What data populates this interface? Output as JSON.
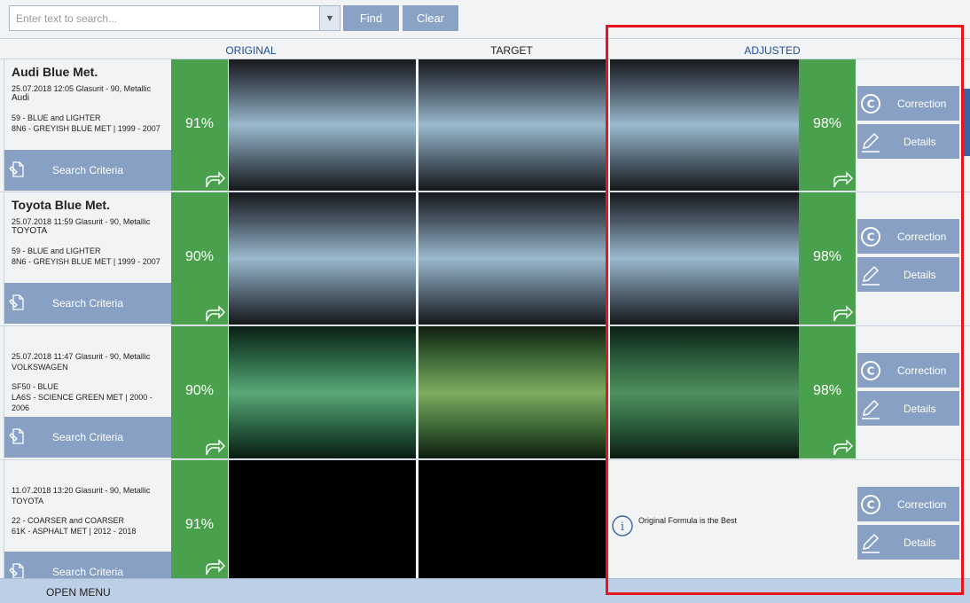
{
  "search": {
    "placeholder": "Enter text to search...",
    "value": ""
  },
  "toolbar": {
    "find_label": "Find",
    "clear_label": "Clear"
  },
  "columns": {
    "original": "ORIGINAL",
    "target": "TARGET",
    "adjusted": "ADJUSTED"
  },
  "colors": {
    "accent": "#87a0c3",
    "match_green": "#4aa14d",
    "highlight": "#e8141c",
    "header_blue": "#1f4e9c"
  },
  "rows": [
    {
      "title": "Audi Blue Met.",
      "line1": "25.07.2018 12:05  Glasurit - 90, Metallic",
      "line2": "Audi",
      "line3": "59 -  BLUE and LIGHTER",
      "line4": "8N6  - GREYISH BLUE MET  |  1999 - 2007",
      "search_label": "Search Criteria",
      "original_match": "91%",
      "adjusted_match": "98%",
      "swatch": "blue",
      "correction_label": "Correction",
      "details_label": "Details"
    },
    {
      "title": "Toyota Blue Met.",
      "line1": "25.07.2018 11:59  Glasurit - 90, Metallic",
      "line2": "TOYOTA",
      "line3": "59 -  BLUE and LIGHTER",
      "line4": "8N6  - GREYISH BLUE MET  |  1999 - 2007",
      "search_label": "Search Criteria",
      "original_match": "90%",
      "adjusted_match": "98%",
      "swatch": "blue",
      "correction_label": "Correction",
      "details_label": "Details"
    },
    {
      "title": "",
      "line1": "25.07.2018 11:47  Glasurit - 90, Metallic",
      "line2": "VOLKSWAGEN",
      "line3": "SF50 -  BLUE",
      "line4": "LA6S  - SCIENCE GREEN MET  |  2000 - 2006",
      "search_label": "Search Criteria",
      "original_match": "90%",
      "adjusted_match": "98%",
      "swatch": "green",
      "correction_label": "Correction",
      "details_label": "Details"
    },
    {
      "title": "",
      "line1": "11.07.2018 13:20  Glasurit - 90, Metallic",
      "line2": "TOYOTA",
      "line3": "22 -  COARSER and COARSER",
      "line4": "61K  - ASPHALT MET  |  2012 - 2018",
      "search_label": "Search Criteria",
      "original_match": "91%",
      "adjusted_match": "",
      "swatch": "black",
      "message": "Original Formula is the Best",
      "correction_label": "Correction",
      "details_label": "Details"
    }
  ],
  "footer": {
    "open_menu_label": "OPEN MENU"
  }
}
